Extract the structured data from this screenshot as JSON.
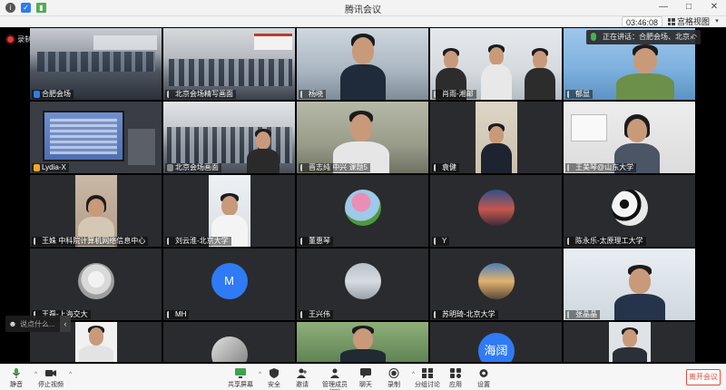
{
  "window": {
    "title": "腾讯会议",
    "minimize": "—",
    "maximize": "□",
    "close": "✕"
  },
  "topbar": {
    "clock": "03:46:08",
    "view_label": "宫格视图",
    "view_caret": "▾"
  },
  "recording": {
    "label": "录制中"
  },
  "speaking": {
    "label": "正在讲话：合肥会场、北京...",
    "back": "↶"
  },
  "tiles": [
    {
      "name": "合肥会场",
      "marker": "blue"
    },
    {
      "name": "北京会场精写画面",
      "marker": "none"
    },
    {
      "name": "杨晓",
      "marker": "none"
    },
    {
      "name": "肖雨-湘邮",
      "marker": "none"
    },
    {
      "name": "郁显",
      "marker": "none"
    },
    {
      "name": "Lydia-X",
      "marker": "orange"
    },
    {
      "name": "北京会场画面",
      "marker": "gray"
    },
    {
      "name": "晋志纯 中兴 课题5",
      "marker": "none"
    },
    {
      "name": "袁健",
      "marker": "none"
    },
    {
      "name": "王美琴@山东大学",
      "marker": "none"
    },
    {
      "name": "王姝 中科院计算机网络信息中心",
      "marker": "none"
    },
    {
      "name": "刘云淮-北京大学",
      "marker": "none"
    },
    {
      "name": "董惠琴",
      "marker": "none"
    },
    {
      "name": "Y",
      "marker": "none"
    },
    {
      "name": "陈永乐-太原理工大学",
      "marker": "none"
    },
    {
      "name": "王磊-上海交大",
      "marker": "none"
    },
    {
      "name": "MH",
      "marker": "none",
      "avatar_letter": "M"
    },
    {
      "name": "王兴伟",
      "marker": "none"
    },
    {
      "name": "苏明琦-北京大学",
      "marker": "none"
    },
    {
      "name": "张晶晶",
      "marker": "none"
    },
    {
      "name": "",
      "marker": "none"
    },
    {
      "name": "",
      "marker": "none"
    },
    {
      "name": "",
      "marker": "none"
    },
    {
      "name": "",
      "marker": "none",
      "avatar_letter": "海阔"
    },
    {
      "name": "",
      "marker": "none"
    }
  ],
  "chat": {
    "placeholder": "说点什么...",
    "collapse": "‹",
    "emoji": "☻"
  },
  "toolbar": {
    "mute": "静音",
    "stop_video": "停止视频",
    "share": "共享屏幕",
    "security": "安全",
    "invite": "邀请",
    "members": "管理成员(25)",
    "chat": "聊天",
    "record": "录制",
    "breakout": "分组讨论",
    "apps": "应用",
    "settings": "设置",
    "leave": "离开会议",
    "caret": "^"
  },
  "colors": {
    "accent": "#2f7bf5",
    "mic_green": "#4caf50",
    "leave_red": "#e64a3b",
    "record_red": "#e53935"
  }
}
